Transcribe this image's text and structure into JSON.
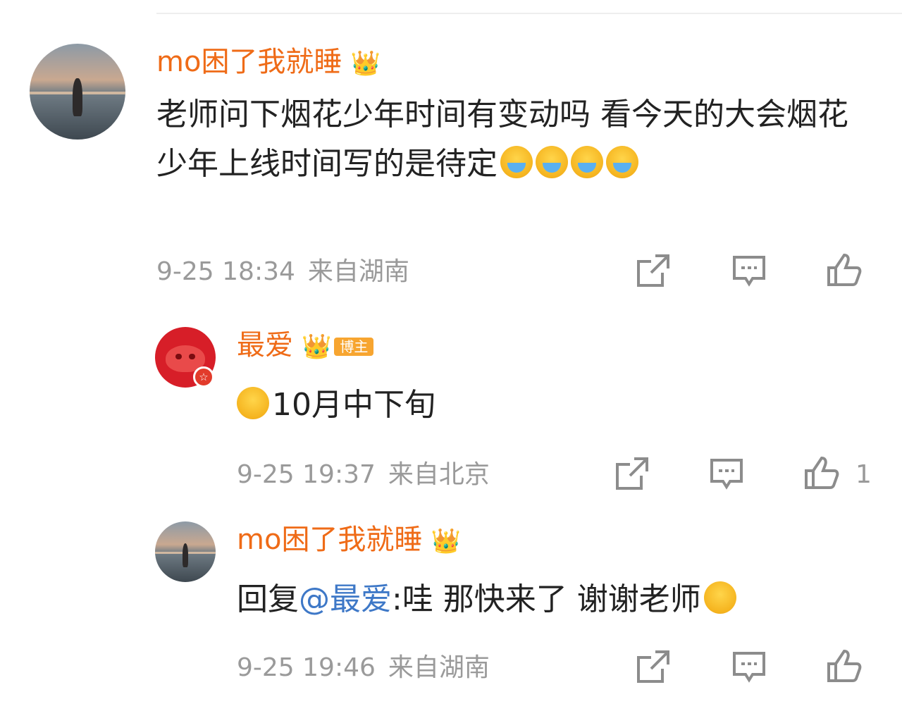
{
  "comments": [
    {
      "name": "mo困了我就睡",
      "text_before": "老师问下烟花少年时间有变动吗 看今天的大会烟花少年上线时间写的是待定",
      "time": "9-25 18:34",
      "location": "来自湖南"
    },
    {
      "name": "最爱",
      "tag": "博主",
      "text": "10月中下旬",
      "time": "9-25 19:37",
      "location": "来自北京",
      "likes": "1"
    },
    {
      "name": "mo困了我就睡",
      "reply_prefix": "回复",
      "mention": "@最爱",
      "text": ":哇 那快来了 谢谢老师",
      "time": "9-25 19:46",
      "location": "来自湖南"
    }
  ],
  "icons": [
    "share-icon",
    "comment-icon",
    "like-icon",
    "crown-icon",
    "crying-emoji",
    "verified-badge-icon"
  ],
  "colors": {
    "name": "#ef6b17",
    "mention": "#3e78c7",
    "meta": "#9a9a9a",
    "text": "#222222"
  }
}
